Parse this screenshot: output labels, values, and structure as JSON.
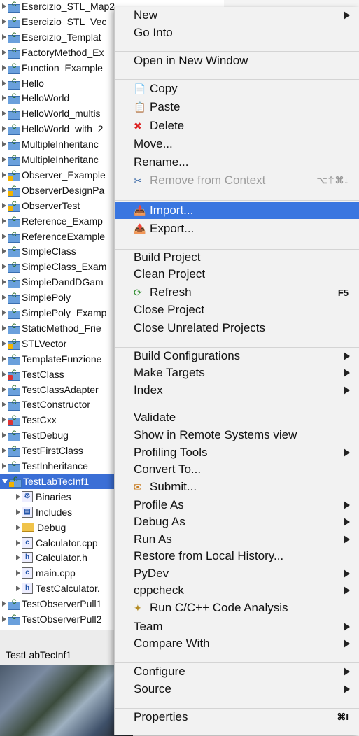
{
  "tree": {
    "projects": [
      {
        "name": "Esercizio_STL_Map2",
        "mark": ""
      },
      {
        "name": "Esercizio_STL_Vec",
        "mark": ""
      },
      {
        "name": "Esercizio_Templat",
        "mark": ""
      },
      {
        "name": "FactoryMethod_Ex",
        "mark": ""
      },
      {
        "name": "Function_Example",
        "mark": ""
      },
      {
        "name": "Hello",
        "mark": ""
      },
      {
        "name": "HelloWorld",
        "mark": ""
      },
      {
        "name": "HelloWorld_multis",
        "mark": ""
      },
      {
        "name": "HelloWorld_with_2",
        "mark": ""
      },
      {
        "name": "MultipleInheritanc",
        "mark": ""
      },
      {
        "name": "MultipleInheritanc",
        "mark": ""
      },
      {
        "name": "Observer_Example",
        "mark": "warn"
      },
      {
        "name": "ObserverDesignPa",
        "mark": "warn"
      },
      {
        "name": "ObserverTest",
        "mark": "warn"
      },
      {
        "name": "Reference_Examp",
        "mark": ""
      },
      {
        "name": "ReferenceExample",
        "mark": ""
      },
      {
        "name": "SimpleClass",
        "mark": ""
      },
      {
        "name": "SimpleClass_Exam",
        "mark": ""
      },
      {
        "name": "SimpleDandDGam",
        "mark": ""
      },
      {
        "name": "SimplePoly",
        "mark": ""
      },
      {
        "name": "SimplePoly_Examp",
        "mark": ""
      },
      {
        "name": "StaticMethod_Frie",
        "mark": ""
      },
      {
        "name": "STLVector",
        "mark": "warn"
      },
      {
        "name": "TemplateFunzione",
        "mark": ""
      },
      {
        "name": "TestClass",
        "mark": "err"
      },
      {
        "name": "TestClassAdapter",
        "mark": ""
      },
      {
        "name": "TestConstructor",
        "mark": ""
      },
      {
        "name": "TestCxx",
        "mark": "err"
      },
      {
        "name": "TestDebug",
        "mark": ""
      },
      {
        "name": "TestFirstClass",
        "mark": ""
      },
      {
        "name": "TestInheritance",
        "mark": ""
      },
      {
        "name": "TestLabTecInf1",
        "mark": "warn"
      }
    ],
    "children": [
      {
        "name": "Binaries",
        "icon": "binaries-icon",
        "glyph": "⚙"
      },
      {
        "name": "Includes",
        "icon": "includes-icon",
        "glyph": "▤"
      },
      {
        "name": "Debug",
        "icon": "folder-icon",
        "glyph": ""
      },
      {
        "name": "Calculator.cpp",
        "icon": "cpp-file-icon",
        "glyph": "c"
      },
      {
        "name": "Calculator.h",
        "icon": "header-file-icon",
        "glyph": "h"
      },
      {
        "name": "main.cpp",
        "icon": "cpp-file-icon",
        "glyph": "c"
      },
      {
        "name": "TestCalculator.",
        "icon": "header-file-icon",
        "glyph": "h"
      }
    ],
    "after": [
      {
        "name": "TestObserverPull1",
        "mark": ""
      },
      {
        "name": "TestObserverPull2",
        "mark": ""
      }
    ]
  },
  "lower_panel": {
    "title": "TestLabTecInf1"
  },
  "menu": {
    "items": [
      {
        "label": "New",
        "arrow": true
      },
      {
        "label": "Go Into"
      },
      {
        "label": "Open in New Window"
      },
      {
        "label": "Copy",
        "icon": "copy-icon"
      },
      {
        "label": "Paste",
        "icon": "paste-icon"
      },
      {
        "label": "Delete",
        "icon": "delete-icon"
      },
      {
        "label": "Move..."
      },
      {
        "label": "Rename..."
      },
      {
        "label": "Remove from Context",
        "icon": "remove-context-icon",
        "disabled": true,
        "shortcut": "⌥⇧⌘↓"
      },
      {
        "label": "Import...",
        "icon": "import-icon",
        "highlighted": true
      },
      {
        "label": "Export...",
        "icon": "export-icon"
      },
      {
        "label": "Build Project"
      },
      {
        "label": "Clean Project"
      },
      {
        "label": "Refresh",
        "icon": "refresh-icon",
        "shortcut": "F5"
      },
      {
        "label": "Close Project"
      },
      {
        "label": "Close Unrelated Projects"
      },
      {
        "label": "Build Configurations",
        "arrow": true
      },
      {
        "label": "Make Targets",
        "arrow": true
      },
      {
        "label": "Index",
        "arrow": true
      },
      {
        "label": "Validate"
      },
      {
        "label": "Show in Remote Systems view"
      },
      {
        "label": "Profiling Tools",
        "arrow": true
      },
      {
        "label": "Convert To..."
      },
      {
        "label": "Submit...",
        "icon": "submit-icon"
      },
      {
        "label": "Profile As",
        "arrow": true
      },
      {
        "label": "Debug As",
        "arrow": true
      },
      {
        "label": "Run As",
        "arrow": true
      },
      {
        "label": "Restore from Local History..."
      },
      {
        "label": "PyDev",
        "arrow": true
      },
      {
        "label": "cppcheck",
        "arrow": true
      },
      {
        "label": "Run C/C++ Code Analysis",
        "icon": "code-analysis-icon"
      },
      {
        "label": "Team",
        "arrow": true
      },
      {
        "label": "Compare With",
        "arrow": true
      },
      {
        "label": "Configure",
        "arrow": true
      },
      {
        "label": "Source",
        "arrow": true
      },
      {
        "label": "Properties",
        "shortcut": "⌘I"
      }
    ]
  },
  "colors": {
    "highlight": "#3a76e0",
    "selection": "#3b6fd6",
    "disabled": "#9a9a9a"
  }
}
